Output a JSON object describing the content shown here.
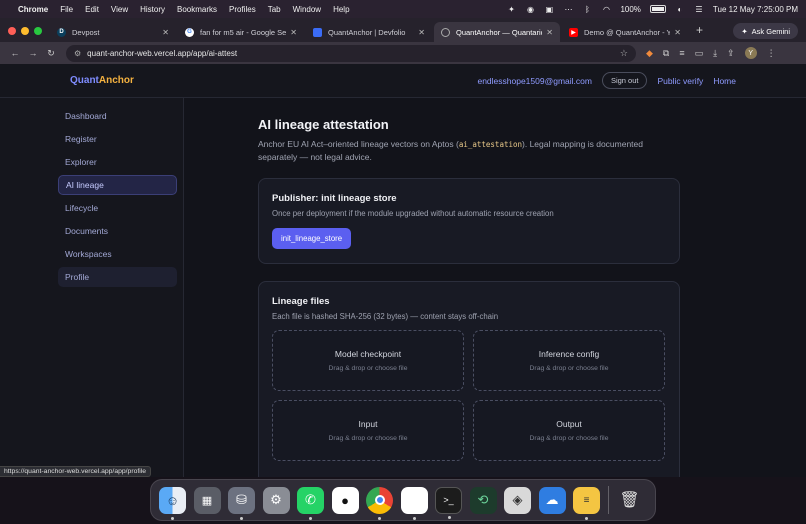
{
  "menubar": {
    "app": "Chrome",
    "items": [
      "File",
      "Edit",
      "View",
      "History",
      "Bookmarks",
      "Profiles",
      "Tab",
      "Window",
      "Help"
    ],
    "battery": "100%",
    "battery_level": 1.0,
    "datetime": "Tue 12 May  7:25:00 PM"
  },
  "tabs": [
    {
      "title": "Devpost",
      "fav": "D",
      "fav_color": "#0b3f5c"
    },
    {
      "title": "fan for m5 air - Google Search",
      "fav": "G",
      "fav_color": "#ffffff"
    },
    {
      "title": "QuantAnchor | Devfolio",
      "fav": "",
      "fav_color": "#3b6cf6"
    },
    {
      "title": "QuantAnchor — Quantarions",
      "fav": "",
      "fav_color": "#777777"
    },
    {
      "title": "Demo @ QuantAnchor - YouTube",
      "fav": "▶",
      "fav_color": "#ff0000"
    }
  ],
  "ask_gemini": "Ask Gemini",
  "address": {
    "url": "quant-anchor-web.vercel.app/app/ai-attest"
  },
  "profile_initial": "Y",
  "app": {
    "brand_part1": "Quant",
    "brand_part2": "Anchor",
    "email": "endlesshope1509@gmail.com",
    "signout": "Sign out",
    "public_verify": "Public verify",
    "home": "Home"
  },
  "sidebar": {
    "items": [
      "Dashboard",
      "Register",
      "Explorer",
      "AI lineage",
      "Lifecycle",
      "Documents",
      "Workspaces",
      "Profile"
    ]
  },
  "page": {
    "title": "AI lineage attestation",
    "desc_before": "Anchor EU AI Act–oriented lineage vectors on Aptos (",
    "desc_code": "ai_attestation",
    "desc_after": "). Legal mapping is documented separately — not legal advice."
  },
  "publisher_card": {
    "title": "Publisher: init lineage store",
    "subtitle": "Once per deployment if the module upgraded without automatic resource creation",
    "button": "init_lineage_store"
  },
  "files_card": {
    "title": "Lineage files",
    "subtitle": "Each file is hashed SHA-256 (32 bytes) — content stays off-chain",
    "drop_hint": "Drag & drop or choose file",
    "slots": [
      "Model checkpoint",
      "Inference config",
      "Input",
      "Output"
    ]
  },
  "status_url": "https://quant-anchor-web.vercel.app/app/profile",
  "colors": {
    "accent": "#5b5ff0",
    "link": "#8f9bff",
    "brand_accent": "#f5b240"
  }
}
